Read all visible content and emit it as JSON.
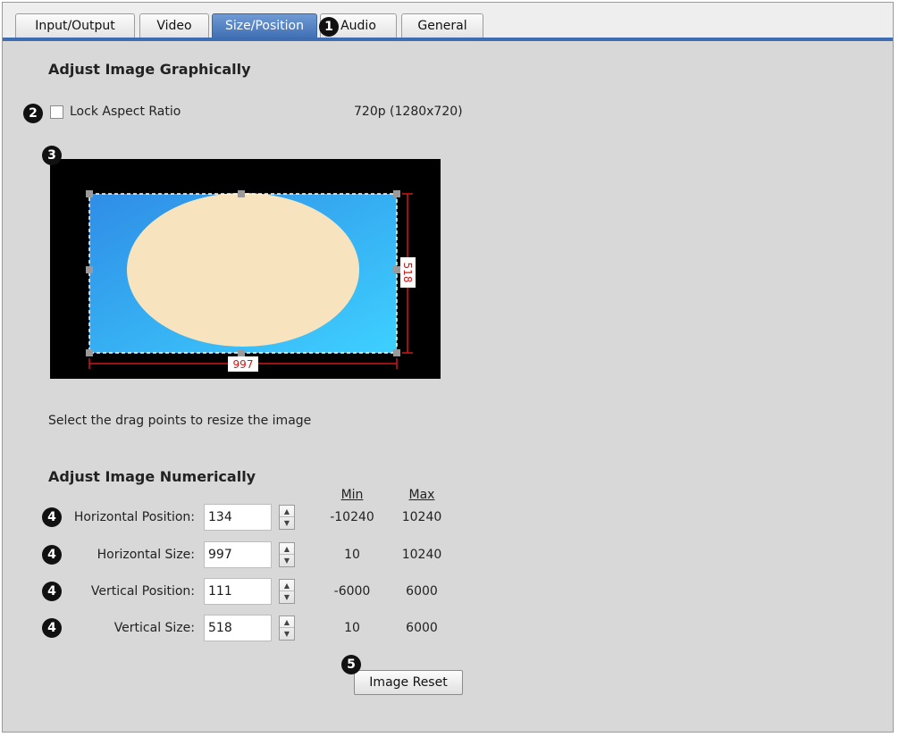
{
  "tabs": [
    {
      "label": "Input/Output"
    },
    {
      "label": "Video"
    },
    {
      "label": "Size/Position"
    },
    {
      "label": "Audio"
    },
    {
      "label": "General"
    }
  ],
  "active_tab": "Size/Position",
  "graphical": {
    "heading": "Adjust Image Graphically",
    "lock_aspect_label": "Lock Aspect Ratio",
    "lock_aspect_checked": false,
    "resolution": "720p (1280x720)",
    "width_readout": "997",
    "height_readout": "518",
    "hint": "Select the drag points to resize the image"
  },
  "numerical": {
    "heading": "Adjust Image Numerically",
    "min_header": "Min",
    "max_header": "Max",
    "rows": [
      {
        "label": "Horizontal Position:",
        "value": "134",
        "min": "-10240",
        "max": "10240"
      },
      {
        "label": "Horizontal Size:",
        "value": "997",
        "min": "10",
        "max": "10240"
      },
      {
        "label": "Vertical Position:",
        "value": "111",
        "min": "-6000",
        "max": "6000"
      },
      {
        "label": "Vertical Size:",
        "value": "518",
        "min": "10",
        "max": "6000"
      }
    ]
  },
  "reset_button": "Image Reset",
  "callouts": {
    "c1": "1",
    "c2": "2",
    "c3": "3",
    "c4": "4",
    "c5": "5"
  },
  "colors": {
    "active_tab": "#3f6fb3",
    "dimension_red": "#d01818",
    "image_blue": "#3aa7f0",
    "ellipse_fill": "#f7e4bf"
  }
}
